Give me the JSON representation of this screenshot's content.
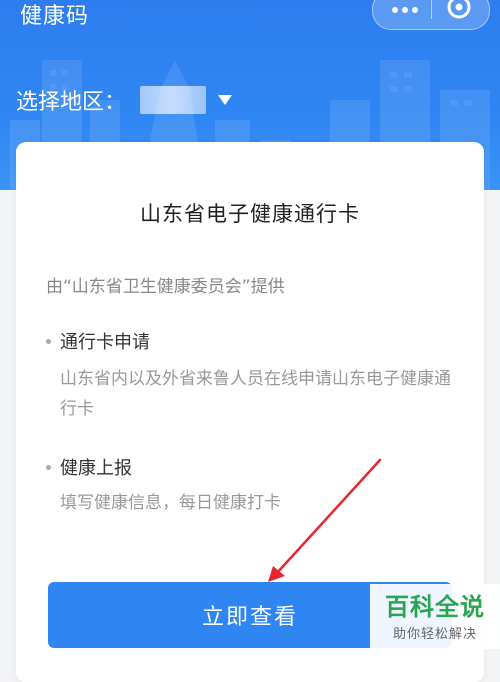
{
  "header": {
    "app_title": "健康码",
    "region_label": "选择地区："
  },
  "card": {
    "title": "山东省电子健康通行卡",
    "provider": "由“山东省卫生健康委员会”提供",
    "items": [
      {
        "title": "通行卡申请",
        "desc": "山东省内以及外省来鲁人员在线申请山东电子健康通行卡"
      },
      {
        "title": "健康上报",
        "desc": "填写健康信息，每日健康打卡"
      }
    ],
    "button_label": "立即查看"
  },
  "watermark": {
    "title": "百科全说",
    "subtitle": "助你轻松解决"
  },
  "colors": {
    "primary": "#2f86f3",
    "annotation_arrow": "#e8262d",
    "watermark_green": "#2aa653"
  }
}
